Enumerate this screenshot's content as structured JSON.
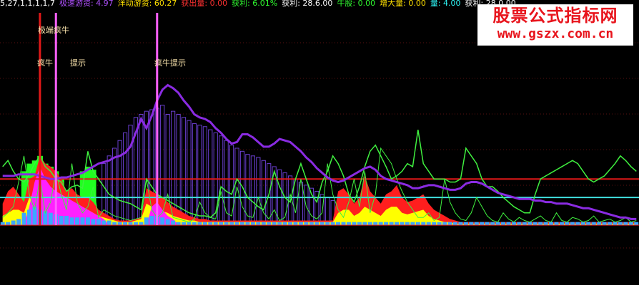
{
  "header": {
    "items": [
      {
        "text": "5,27,1,1,1,1,7",
        "color": "#ffffff"
      },
      {
        "text": "极速游资: 4.97",
        "color": "#b050ff"
      },
      {
        "text": "洋动游资: 60.27",
        "color": "#ffe000"
      },
      {
        "text": "获出量: 0.00",
        "color": "#ff3030"
      },
      {
        "text": "获利: 6.01%",
        "color": "#30ff30"
      },
      {
        "text": "获利: 28.6.00",
        "color": "#ffffff"
      },
      {
        "text": "牛股: 0.00",
        "color": "#30ff30"
      },
      {
        "text": "增大量: 0.00",
        "color": "#ffe000"
      },
      {
        "text": "量: 4.00",
        "color": "#30ffff"
      },
      {
        "text": "获利: 28.0.00",
        "color": "#ffffff"
      }
    ]
  },
  "watermark": {
    "line1": "股票公式指标网",
    "line2": "www.gszx.com.cn"
  },
  "signals": {
    "extreme_bull": "极端疯牛",
    "crazy_bull_1": "疯牛",
    "crazy_bull_2": "提示",
    "crazy_bull_3": "疯牛提示",
    "crazy_bull_4": "疯牛提示"
  },
  "chart_data": {
    "type": "area",
    "x_count": 120,
    "ylim": [
      0,
      100
    ],
    "grid": true,
    "reference_lines": [
      {
        "name": "red",
        "value": 30,
        "color": "#e01818"
      },
      {
        "name": "cyan",
        "value": 18,
        "color": "#40e0e0"
      }
    ],
    "signal_markers": [
      {
        "x": 7,
        "color": "#e01818",
        "label_key": "extreme_bull"
      },
      {
        "x": 10,
        "color": "#ff60ff",
        "label_key": "crazy_bull_1"
      },
      {
        "x": 29,
        "color": "#ff60ff",
        "label_key": "crazy_bull_4"
      }
    ],
    "purple_line": [
      32,
      32,
      32,
      33,
      33,
      33,
      33,
      32,
      31,
      30,
      30,
      31,
      31,
      32,
      33,
      34,
      36,
      38,
      40,
      41,
      42,
      44,
      45,
      47,
      51,
      60,
      69,
      63,
      71,
      81,
      88,
      91,
      89,
      86,
      81,
      77,
      72,
      70,
      69,
      67,
      63,
      60,
      56,
      53,
      54,
      59,
      59,
      57,
      54,
      51,
      51,
      53,
      56,
      55,
      54,
      51,
      48,
      44,
      41,
      37,
      34,
      31,
      29,
      28,
      29,
      31,
      33,
      35,
      37,
      38,
      36,
      32,
      30,
      29,
      28,
      27,
      26,
      24,
      24,
      25,
      26,
      26,
      25,
      24,
      23,
      23,
      24,
      27,
      28,
      28,
      27,
      25,
      23,
      21,
      20,
      19,
      18,
      17,
      17,
      17,
      16,
      16,
      15,
      15,
      14,
      14,
      14,
      13,
      12,
      11,
      11,
      10,
      9,
      8,
      7,
      6,
      5,
      5,
      4,
      4
    ],
    "purple_bars": [
      0,
      0,
      0,
      0,
      0,
      0,
      0,
      0,
      0,
      0,
      0,
      0,
      0,
      0,
      0,
      0,
      0,
      0,
      0,
      40,
      45,
      50,
      55,
      60,
      65,
      70,
      72,
      74,
      75,
      76,
      78,
      72,
      74,
      72,
      70,
      68,
      66,
      65,
      64,
      62,
      60,
      58,
      55,
      52,
      50,
      48,
      46,
      45,
      44,
      42,
      40,
      38,
      36,
      34,
      32,
      30,
      28,
      26,
      24,
      22,
      20,
      18,
      16,
      14,
      12,
      10,
      8,
      6,
      4,
      0,
      0,
      0,
      0,
      0,
      0,
      0,
      0,
      0,
      0,
      0,
      0,
      0,
      0,
      0,
      0,
      0,
      0,
      0,
      0,
      0,
      0,
      0,
      0,
      0,
      0,
      0,
      0,
      0,
      0,
      0,
      0,
      0,
      0,
      0,
      0,
      0,
      0,
      0,
      0,
      0,
      0,
      0,
      0,
      0,
      0,
      0,
      0,
      0,
      0,
      0
    ],
    "green_line": [
      38,
      42,
      35,
      30,
      28,
      33,
      40,
      45,
      38,
      35,
      30,
      28,
      22,
      25,
      26,
      24,
      48,
      35,
      30,
      25,
      20,
      18,
      16,
      15,
      14,
      12,
      10,
      30,
      25,
      20,
      18,
      16,
      14,
      12,
      10,
      8,
      7,
      6,
      6,
      5,
      8,
      25,
      22,
      20,
      30,
      25,
      18,
      15,
      12,
      10,
      20,
      35,
      25,
      18,
      15,
      30,
      40,
      30,
      20,
      15,
      28,
      35,
      45,
      40,
      32,
      20,
      15,
      25,
      38,
      48,
      52,
      45,
      38,
      30,
      32,
      35,
      40,
      38,
      62,
      40,
      35,
      30,
      30,
      30,
      28,
      28,
      30,
      50,
      45,
      40,
      30,
      25,
      25,
      22,
      18,
      15,
      12,
      10,
      8,
      8,
      20,
      30,
      32,
      34,
      36,
      38,
      40,
      42,
      40,
      35,
      30,
      28,
      30,
      32,
      36,
      40,
      45,
      42,
      38,
      35
    ],
    "thin_green_line": [
      5,
      8,
      12,
      28,
      45,
      20,
      10,
      30,
      8,
      15,
      35,
      20,
      10,
      40,
      15,
      8,
      12,
      25,
      5,
      10,
      8,
      6,
      5,
      4,
      3,
      4,
      5,
      30,
      10,
      5,
      8,
      20,
      5,
      4,
      3,
      2,
      4,
      15,
      8,
      5,
      4,
      22,
      8,
      6,
      25,
      12,
      6,
      5,
      18,
      8,
      4,
      10,
      3,
      5,
      20,
      8,
      30,
      12,
      6,
      4,
      8,
      40,
      20,
      10,
      5,
      15,
      30,
      12,
      35,
      8,
      20,
      50,
      45,
      40,
      30,
      22,
      15,
      10,
      5,
      5,
      8,
      3,
      5,
      30,
      15,
      8,
      4,
      3,
      8,
      18,
      12,
      6,
      3,
      2,
      8,
      4,
      2,
      5,
      3,
      2,
      4,
      6,
      3,
      2,
      8,
      3,
      2,
      5,
      4,
      2,
      3,
      6,
      2,
      3,
      4,
      2,
      3,
      5,
      2,
      3
    ],
    "red_area": [
      14,
      22,
      25,
      20,
      15,
      30,
      32,
      45,
      40,
      38,
      35,
      30,
      22,
      24,
      20,
      18,
      18,
      15,
      10,
      8,
      6,
      4,
      3,
      3,
      3,
      4,
      5,
      24,
      22,
      20,
      18,
      15,
      12,
      10,
      8,
      6,
      5,
      4,
      4,
      3,
      3,
      3,
      3,
      3,
      3,
      3,
      3,
      3,
      3,
      3,
      3,
      3,
      3,
      3,
      3,
      3,
      3,
      3,
      3,
      3,
      3,
      3,
      3,
      22,
      24,
      20,
      14,
      18,
      32,
      22,
      18,
      14,
      20,
      22,
      26,
      18,
      15,
      16,
      18,
      20,
      14,
      10,
      8,
      6,
      4,
      3,
      2,
      2,
      2,
      2,
      2,
      2,
      2,
      2,
      2,
      2,
      2,
      2,
      2,
      2,
      2,
      2,
      2,
      2,
      2,
      2,
      2,
      2,
      2,
      2,
      2,
      2,
      2,
      2,
      2,
      2,
      2,
      2,
      2,
      2
    ],
    "yellow_area": [
      6,
      8,
      10,
      10,
      8,
      18,
      20,
      25,
      22,
      20,
      18,
      15,
      12,
      14,
      12,
      10,
      10,
      8,
      6,
      5,
      4,
      3,
      2,
      2,
      2,
      3,
      4,
      14,
      12,
      10,
      9,
      8,
      6,
      5,
      4,
      3,
      3,
      2,
      2,
      2,
      2,
      2,
      2,
      2,
      2,
      2,
      2,
      2,
      2,
      2,
      2,
      2,
      2,
      2,
      2,
      2,
      2,
      2,
      2,
      2,
      2,
      2,
      2,
      8,
      10,
      10,
      6,
      8,
      12,
      10,
      8,
      6,
      10,
      12,
      12,
      8,
      7,
      8,
      9,
      10,
      6,
      4,
      3,
      2,
      2,
      1,
      1,
      1,
      1,
      1,
      1,
      1,
      1,
      1,
      1,
      1,
      1,
      1,
      1,
      1,
      1,
      1,
      1,
      1,
      1,
      1,
      1,
      1,
      1,
      1,
      1,
      1,
      1,
      1,
      1,
      1,
      1,
      1,
      1,
      1
    ],
    "green_block": [
      0,
      0,
      0,
      0,
      35,
      40,
      42,
      45,
      40,
      38,
      35,
      30,
      0,
      0,
      0,
      35,
      38,
      36,
      0,
      0,
      0,
      0,
      0,
      0,
      0,
      0,
      0,
      0,
      0,
      0,
      0,
      0,
      0,
      0,
      0,
      0,
      0,
      0,
      0,
      0,
      0,
      0,
      0,
      0,
      0,
      0,
      0,
      0,
      0,
      0,
      0,
      0,
      0,
      0,
      0,
      0,
      0,
      0,
      0,
      0,
      0,
      0,
      0,
      0,
      0,
      0,
      0,
      0,
      0,
      0,
      0,
      0,
      0,
      0,
      0,
      0,
      0,
      0,
      0,
      0,
      0,
      0,
      0,
      0,
      0,
      0,
      0,
      0,
      0,
      0,
      0,
      0,
      0,
      0,
      0,
      0,
      0,
      0,
      0,
      0,
      0,
      0,
      0,
      0,
      0,
      0,
      0,
      0,
      0,
      0,
      0,
      0,
      0,
      0,
      0,
      0,
      0,
      0,
      0,
      0
    ],
    "magenta_area": [
      0,
      0,
      0,
      0,
      0,
      12,
      28,
      38,
      30,
      25,
      22,
      20,
      18,
      16,
      14,
      12,
      10,
      8,
      6,
      4,
      0,
      0,
      0,
      0,
      0,
      0,
      0,
      0,
      12,
      15,
      10,
      6,
      4,
      0,
      0,
      0,
      0,
      0,
      0,
      0,
      0,
      0,
      0,
      0,
      0,
      0,
      0,
      0,
      0,
      0,
      0,
      0,
      0,
      0,
      0,
      0,
      0,
      0,
      0,
      0,
      0,
      0,
      0,
      0,
      0,
      0,
      0,
      0,
      0,
      0,
      0,
      0,
      0,
      0,
      0,
      0,
      0,
      0,
      0,
      0,
      0,
      0,
      0,
      0,
      0,
      0,
      0,
      0,
      0,
      0,
      0,
      0,
      0,
      0,
      0,
      0,
      0,
      0,
      0,
      0,
      0,
      0,
      0,
      0,
      0,
      0,
      0,
      0,
      0,
      0,
      0,
      0,
      0,
      0,
      0,
      0,
      0,
      0,
      0,
      0
    ],
    "blue_area": [
      2,
      2,
      3,
      4,
      8,
      10,
      12,
      10,
      9,
      8,
      7,
      6,
      6,
      5,
      5,
      5,
      5,
      4,
      4,
      3,
      3,
      2,
      2,
      2,
      2,
      2,
      2,
      5,
      6,
      6,
      5,
      4,
      3,
      2,
      2,
      2,
      2,
      2,
      2,
      2,
      2,
      2,
      2,
      2,
      2,
      2,
      2,
      2,
      2,
      2,
      2,
      2,
      2,
      2,
      2,
      2,
      2,
      2,
      2,
      2,
      2,
      2,
      2,
      2,
      2,
      2,
      2,
      2,
      2,
      2,
      2,
      2,
      2,
      2,
      2,
      2,
      2,
      2,
      2,
      2,
      2,
      2,
      2,
      2,
      2,
      2,
      2,
      2,
      2,
      2,
      2,
      2,
      2,
      2,
      2,
      2,
      2,
      2,
      2,
      2,
      2,
      2,
      2,
      2,
      2,
      2,
      2,
      2,
      2,
      2,
      2,
      2,
      2,
      2,
      2,
      2,
      2,
      2,
      2,
      2
    ],
    "colors": {
      "purple": "#8a2be2",
      "purple_bar": "#6a3fd0",
      "green": "#3ff03f",
      "red": "#ff1e1e",
      "yellow": "#ffff00",
      "magenta": "#ff20ff",
      "blue": "#3aa8ff",
      "green_block": "#20ff20"
    }
  }
}
